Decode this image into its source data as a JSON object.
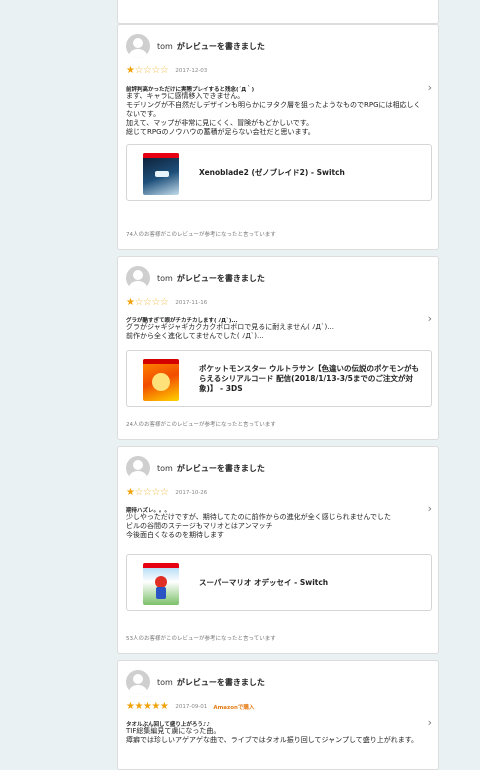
{
  "reviews": [
    {
      "user": "tom",
      "action": "がレビューを書きました",
      "stars": [
        "★",
        "☆",
        "☆",
        "☆",
        "☆"
      ],
      "date": "2017-12-03",
      "title": "前評判高かっただけに実際プレイすると残念(´Д｀)",
      "body": "ます、キャラに感情移入できません。\nモデリングが不自然だしデザインも明らかにヲタク層を狙ったようなものでRPGには相応しくないです。\n加えて、マップが非常に見にくく、冒険がもどかしいです。\n総じてRPGのノウハウの蓄積が足らない会社だと思います。",
      "product": "Xenoblade2 (ゼノブレイド2) - Switch",
      "helpful": "74人のお客様がこのレビューが参考になったと言っています"
    },
    {
      "user": "tom",
      "action": "がレビューを書きました",
      "stars": [
        "★",
        "☆",
        "☆",
        "☆",
        "☆"
      ],
      "date": "2017-11-16",
      "title": "グラが酷すぎて眼がチカチカします( ﾉД`)...",
      "body": "グラがジャギジャギカクカクボロボロで見るに耐えません( ﾉД`)...\n前作から全く進化してませんでした( ﾉД`)...",
      "product": "ポケットモンスター ウルトラサン【色違いの伝説のポケモンがもらえるシリアルコード 配信(2018/1/13-3/5までのご注文が対象)】 - 3DS",
      "helpful": "24人のお客様がこのレビューが参考になったと言っています"
    },
    {
      "user": "tom",
      "action": "がレビューを書きました",
      "stars": [
        "★",
        "☆",
        "☆",
        "☆",
        "☆"
      ],
      "date": "2017-10-26",
      "title": "期待ハズレ。。。",
      "body": "少しやっただけですが、期待してたのに前作からの進化が全く感じられませんでした\nビルの谷間のステージもマリオとはアンマッチ\n今後面白くなるのを期待します",
      "product": "スーパーマリオ オデッセイ - Switch",
      "helpful": "53人のお客様がこのレビューが参考になったと言っています"
    },
    {
      "user": "tom",
      "action": "がレビューを書きました",
      "stars": [
        "★",
        "★",
        "★",
        "★",
        "★"
      ],
      "date": "2017-09-01",
      "badge": "Amazonで購入",
      "title": "タオルぶん回して盛り上がろう♪♪",
      "body": "TIF総集編見て虜になった曲。\n瘴癖では珍しいアゲアゲな曲で、ライブではタオル振り回してジャンプして盛り上がれます。"
    }
  ],
  "colors": {
    "star": "#f0a20a",
    "badge": "#e47911",
    "background": "#e9f1f3"
  }
}
